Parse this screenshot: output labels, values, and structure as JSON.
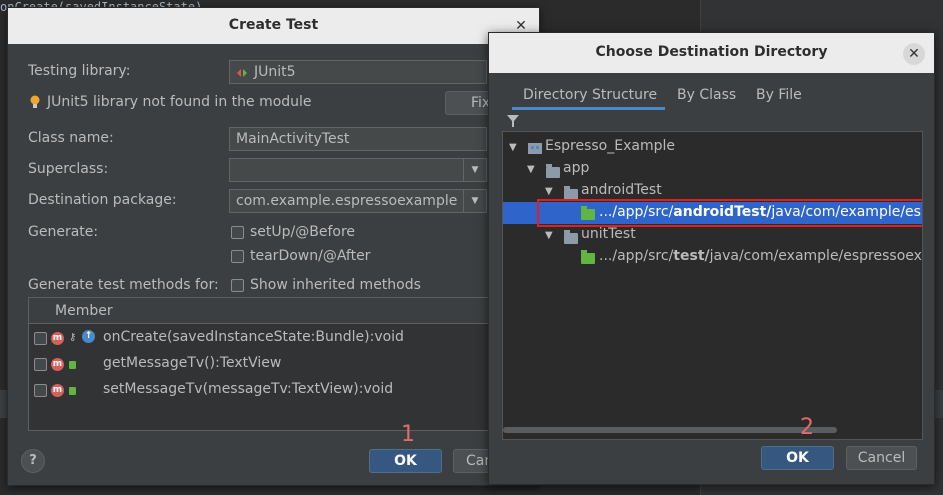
{
  "ide": {
    "code_fragment": "onCreate(savedInstanceState)"
  },
  "create_test": {
    "title": "Create Test",
    "testing_library_label": "Testing library:",
    "testing_library_value": "JUnit5",
    "warning_text": "JUnit5 library not found in the module",
    "fix_button": "Fix",
    "class_name_label": "Class name:",
    "class_name_value": "MainActivityTest",
    "superclass_label": "Superclass:",
    "superclass_value": "",
    "destination_package_label": "Destination package:",
    "destination_package_value": "com.example.espressoexample",
    "generate_label": "Generate:",
    "setup_label": "setUp/@Before",
    "teardown_label": "tearDown/@After",
    "generate_methods_label": "Generate test methods for:",
    "show_inherited_label": "Show inherited methods",
    "member_header": "Member",
    "members": [
      "onCreate(savedInstanceState:Bundle):void",
      "getMessageTv():TextView",
      "setMessageTv(messageTv:TextView):void"
    ],
    "ok_button": "OK",
    "cancel_button": "Can",
    "help_button": "?",
    "annotation": "1"
  },
  "dest_dialog": {
    "title": "Choose Destination Directory",
    "tabs": [
      "Directory Structure",
      "By Class",
      "By File"
    ],
    "active_tab": 0,
    "tree": {
      "root": "Espresso_Example",
      "app": "app",
      "android_test": "androidTest",
      "android_test_path_prefix": ".../app/src/",
      "android_test_path_bold": "androidTest/",
      "android_test_path_suffix": "java/com/example/esp",
      "unit_test": "unitTest",
      "unit_test_path_prefix": ".../app/src/",
      "unit_test_path_bold": "test/",
      "unit_test_path_suffix": "java/com/example/espressoex"
    },
    "ok_button": "OK",
    "cancel_button": "Cancel",
    "annotation": "2"
  },
  "colors": {
    "accent": "#365880",
    "selection": "#2f65ca",
    "annotation": "#e02020"
  }
}
